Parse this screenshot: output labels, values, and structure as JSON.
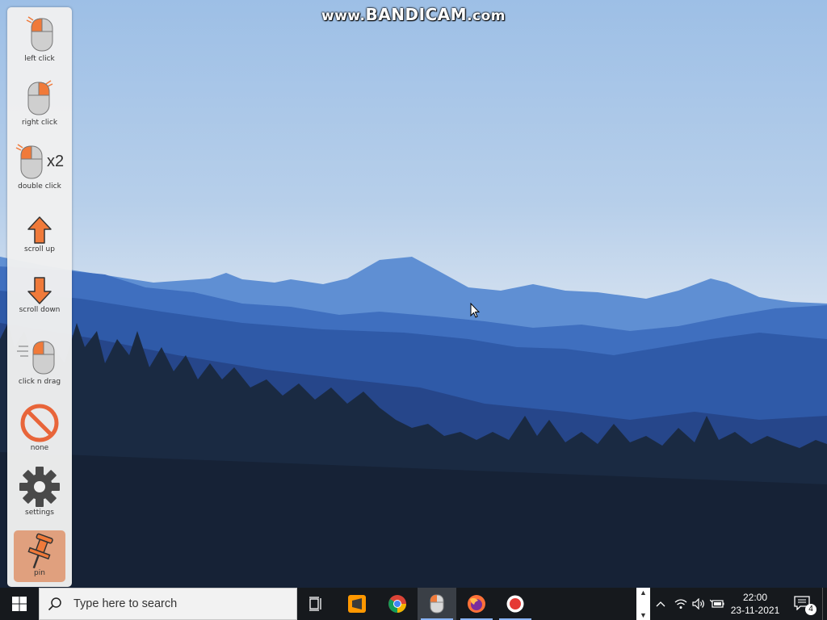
{
  "watermark": {
    "prefix": "www.",
    "brand": "BANDICAM",
    "suffix": ".com"
  },
  "panel": {
    "tools": [
      {
        "id": "left-click",
        "label": "left click",
        "icon": "mouse-left-click-icon"
      },
      {
        "id": "right-click",
        "label": "right click",
        "icon": "mouse-right-click-icon"
      },
      {
        "id": "double-click",
        "label": "double click",
        "icon": "mouse-double-click-icon",
        "badge": "x2"
      },
      {
        "id": "scroll-up",
        "label": "scroll up",
        "icon": "arrow-up-icon"
      },
      {
        "id": "scroll-down",
        "label": "scroll down",
        "icon": "arrow-down-icon"
      },
      {
        "id": "click-n-drag",
        "label": "click n drag",
        "icon": "mouse-drag-icon"
      },
      {
        "id": "none",
        "label": "none",
        "icon": "prohibited-icon"
      },
      {
        "id": "settings",
        "label": "settings",
        "icon": "gear-icon"
      },
      {
        "id": "pin",
        "label": "pin",
        "icon": "pushpin-icon",
        "active": true
      }
    ]
  },
  "taskbar": {
    "search_placeholder": "Type here to search",
    "apps": [
      "task-view",
      "sublime-text",
      "chrome",
      "mouse-tool",
      "firefox",
      "recorder"
    ],
    "active_app": "mouse-tool",
    "time": "22:00",
    "date": "23-11-2021",
    "notification_count": "4"
  },
  "colors": {
    "accent_orange": "#f07a3a",
    "taskbar_bg": "#16191d",
    "sky_top": "#9fc0e6"
  }
}
